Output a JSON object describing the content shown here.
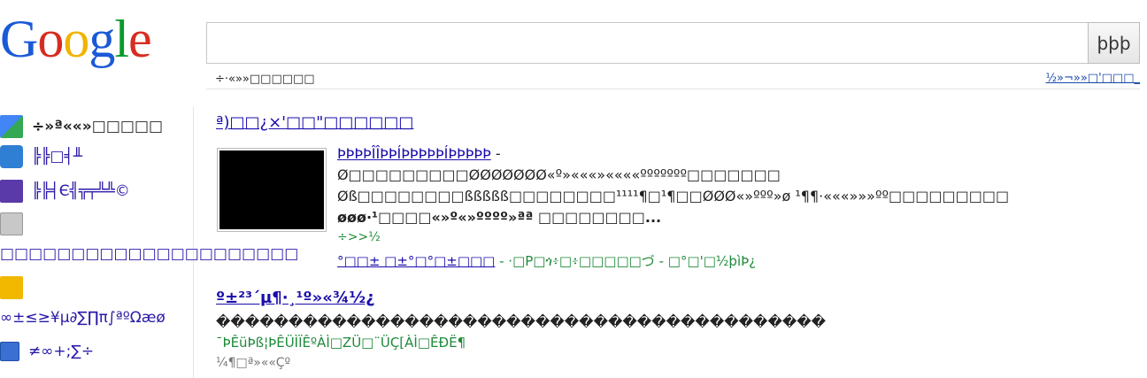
{
  "logo": {
    "letters": [
      "G",
      "o",
      "o",
      "g",
      "l",
      "e"
    ]
  },
  "search": {
    "value": "",
    "button_label": "þþþ"
  },
  "hint": {
    "left": "÷·«»»□□□□□□",
    "right": "½»¬»»□'□□□_"
  },
  "sidebar": {
    "items": [
      {
        "label": "÷»ª««»□□□□□",
        "icon": "web-icon"
      },
      {
        "label": "╠╠□╡╨",
        "icon": "camera-icon"
      },
      {
        "label": "╠╠╡Є╣╦╤╩╩©",
        "icon": "video-icon"
      },
      {
        "label": "",
        "icon": "news-icon"
      },
      {
        "label": "□□□□□□□□□□□□□□□□□□□□□",
        "icon": ""
      },
      {
        "label": "",
        "icon": "tag-icon"
      },
      {
        "label": "∞±≤≥¥µ∂∑∏π∫ªºΩæø",
        "icon": ""
      },
      {
        "label": "≠∞+;∑÷",
        "icon": "more-icon"
      }
    ]
  },
  "results": [
    {
      "title": "ª)□□¿×'□□\"□□□□□□",
      "sub_title": "ÞÞÞÞÎÎÞÞÍÞÞÞÞÞÍÞÞÞÞÞ",
      "sub_suffix": " -",
      "lines": [
        "Ø□□□□□□□□□ØØØØØØØ«º»«««»««««ººººººº□□□□□□□",
        "Øß□□□□□□□□ßßßßß□□□□□□□□¹¹¹¹¶□¹¶□□ØØØ«»ººº»ø ¹¶¶·«««»»»ºº□□□□□□□□□",
        "øøø·¹□□□□«»º«»ºººº»ªª □□□□□□□□..."
      ],
      "green": "÷>>½",
      "footer_link": "°□□± □±°□°□±□□□",
      "footer_mid": " - ·□P□ጎ፥□፥□□□□□づ - □°□'□½þìÞ¿"
    },
    {
      "title": "º±²³´µ¶·¸¹º»«¾½¿",
      "line": "������������������������������������������",
      "green": "¯ÞÊüÞß¦ÞÊÜÌÏÊºÀÌ□ZÜ□¨ÜÇ[ÀÌ□ÊÐË¶",
      "gray": "¼¶□ª»««Çº"
    }
  ]
}
